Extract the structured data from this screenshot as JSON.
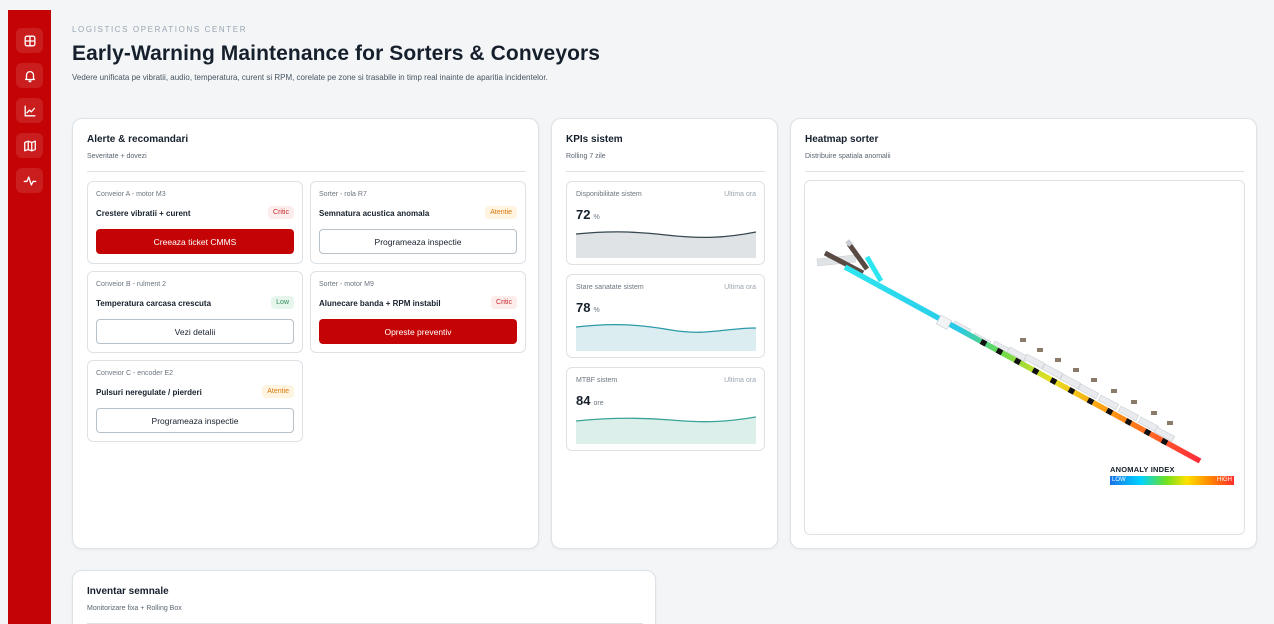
{
  "nav": {
    "items": [
      {
        "icon": "dashboard-icon"
      },
      {
        "icon": "bell-icon"
      },
      {
        "icon": "chart-line-icon"
      },
      {
        "icon": "map-icon"
      },
      {
        "icon": "activity-icon"
      }
    ]
  },
  "header": {
    "eyebrow": "LOGISTICS OPERATIONS CENTER",
    "title": "Early-Warning Maintenance for Sorters & Conveyors",
    "subtitle": "Vedere unificata pe vibratii, audio, temperatura, curent si RPM, corelate pe zone si trasabile in timp real inainte de aparitia incidentelor."
  },
  "alerts": {
    "title": "Alerte & recomandari",
    "subtitle": "Severitate + dovezi",
    "items": [
      {
        "source": "Conveior A - motor M3",
        "title": "Crestere vibratii + curent",
        "badge": "Critic",
        "level": "critic",
        "action": "Creeaza ticket CMMS",
        "primary": true
      },
      {
        "source": "Sorter - rola R7",
        "title": "Semnatura acustica anomala",
        "badge": "Atentie",
        "level": "atentie",
        "action": "Programeaza inspectie",
        "primary": false
      },
      {
        "source": "Conveior B - rulment 2",
        "title": "Temperatura carcasa crescuta",
        "badge": "Low",
        "level": "low",
        "action": "Vezi detalii",
        "primary": false
      },
      {
        "source": "Sorter - motor M9",
        "title": "Alunecare banda + RPM instabil",
        "badge": "Critic",
        "level": "critic",
        "action": "Opreste preventiv",
        "primary": true
      },
      {
        "source": "Conveior C - encoder E2",
        "title": "Pulsuri neregulate / pierderi",
        "badge": "Atentie",
        "level": "atentie",
        "action": "Programeaza inspectie",
        "primary": false
      }
    ]
  },
  "kpis": {
    "title": "KPIs sistem",
    "subtitle": "Rolling 7 zile",
    "items": [
      {
        "label": "Disponibilitate sistem",
        "period": "Ultima ora",
        "value": "72",
        "unit": "%",
        "color": "#37474f",
        "fill": "#dfe3e6"
      },
      {
        "label": "Stare sanatate sistem",
        "period": "Ultima ora",
        "value": "78",
        "unit": "%",
        "color": "#2a9aa8",
        "fill": "#dcedf1"
      },
      {
        "label": "MTBF sistem",
        "period": "Ultima ora",
        "value": "84",
        "unit": "ore",
        "color": "#3aa597",
        "fill": "#dcefeb"
      }
    ]
  },
  "heatmap": {
    "title": "Heatmap sorter",
    "subtitle": "Distribuire spatiala anomalii",
    "legend_title": "ANOMALY INDEX",
    "legend_low": "LOW",
    "legend_high": "HIGH"
  },
  "inventory": {
    "title": "Inventar semnale",
    "subtitle": "Monitorizare fixa + Rolling Box"
  }
}
